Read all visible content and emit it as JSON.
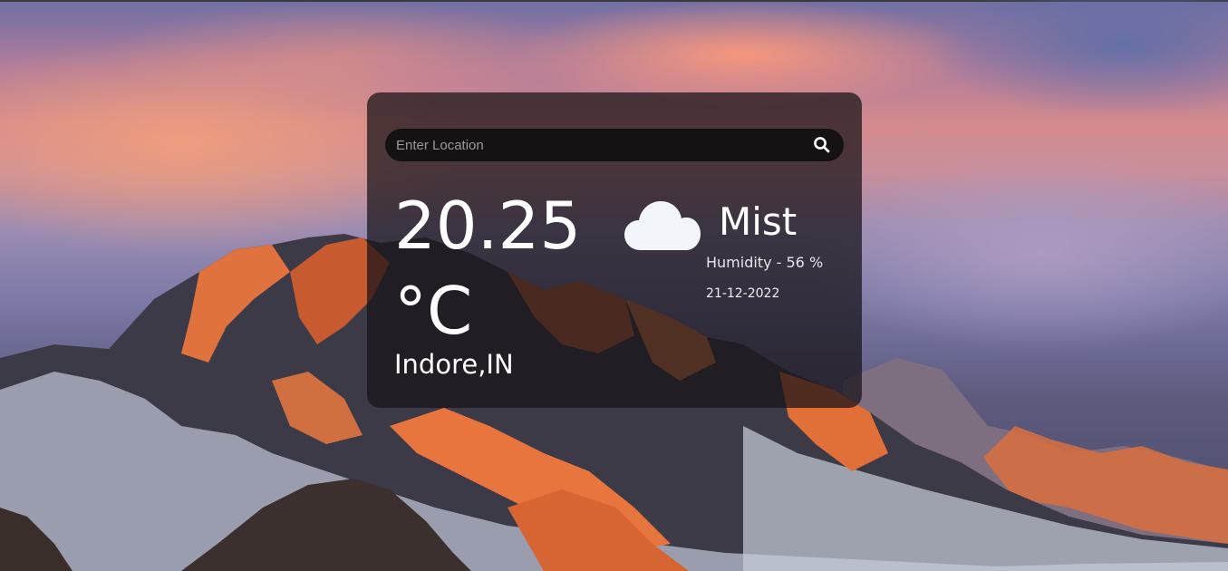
{
  "search": {
    "placeholder": "Enter Location",
    "value": "",
    "icon": "search-icon"
  },
  "weather": {
    "temperature": "20.25",
    "unit": "°C",
    "location": "Indore,IN",
    "condition": "Mist",
    "condition_icon": "cloud-icon",
    "humidity": "Humidity - 56 %",
    "date": "21-12-2022"
  },
  "colors": {
    "card_background": "#161216",
    "search_background": "#151214",
    "text": "#ffffff",
    "cloud_icon": "#f2f6fb"
  }
}
